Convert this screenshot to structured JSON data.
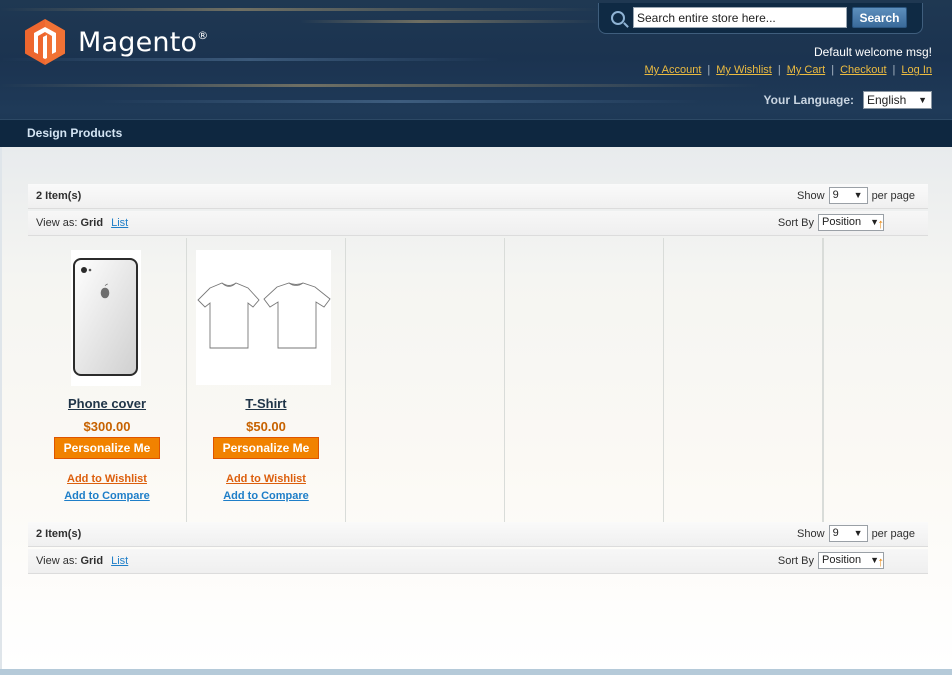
{
  "header": {
    "logo_text": "Magento",
    "logo_mark": "®",
    "search": {
      "placeholder": "Search entire store here...",
      "button_label": "Search"
    },
    "welcome": "Default welcome msg!",
    "links": [
      "My Account",
      "My Wishlist",
      "My Cart",
      "Checkout",
      "Log In"
    ],
    "language": {
      "label": "Your Language:",
      "selected": "English"
    }
  },
  "nav": {
    "title": "Design Products"
  },
  "toolbar": {
    "amount": "2 Item(s)",
    "show_label": "Show",
    "show_value": "9",
    "per_page_label": "per page",
    "view_as_label": "View as:",
    "view_grid": "Grid",
    "view_list": "List",
    "sort_by_label": "Sort By",
    "sort_value": "Position",
    "sort_arrow": "↑"
  },
  "products": [
    {
      "name": "Phone cover",
      "price": "$300.00",
      "button": "Personalize Me",
      "wishlist": "Add to Wishlist",
      "compare": "Add to Compare"
    },
    {
      "name": "T-Shirt",
      "price": "$50.00",
      "button": "Personalize Me",
      "wishlist": "Add to Wishlist",
      "compare": "Add to Compare"
    }
  ],
  "colors": {
    "accent_orange": "#f18200",
    "link_blue": "#1e7ec8",
    "header_navy": "#1f3852",
    "price": "#c76200"
  }
}
